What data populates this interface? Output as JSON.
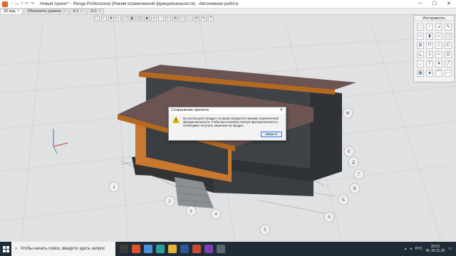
{
  "window": {
    "title": "Новый проект* - Renga Professional (Режим ограниченной функциональности) - Автономная работа",
    "minimize": "─",
    "maximize": "☐",
    "close": "✕"
  },
  "tabs": [
    {
      "label": "3D-вид",
      "active": true
    },
    {
      "label": "Обозначить уровень",
      "active": false
    },
    {
      "label": "К-1",
      "active": false
    },
    {
      "label": "О-1",
      "active": false
    }
  ],
  "palette": {
    "title": "Инструменты"
  },
  "dialog": {
    "title": "Сохранение проекта",
    "message": "Вы используете продукт, который находится в режиме ограниченной функциональности. Чтобы восстановить полную функциональность, необходимо получить лицензию на продукт.",
    "ok_label": "Закрыть",
    "close_glyph": "✕"
  },
  "grid_labels": {
    "numbers": [
      "1",
      "2",
      "3",
      "4",
      "5"
    ],
    "letters": [
      "А",
      "Б",
      "В",
      "Г",
      "Д",
      "Е",
      "Ж"
    ]
  },
  "taskbar": {
    "search_placeholder": "Чтобы начать поиск, введите здесь запрос",
    "lang": "РУС",
    "time": "20:01",
    "date": "Вс 30.11.25"
  },
  "colors": {
    "roof": "#6b5452",
    "wall": "#3f4247",
    "timber": "#c9782f",
    "accent": "#3a7bd5"
  }
}
